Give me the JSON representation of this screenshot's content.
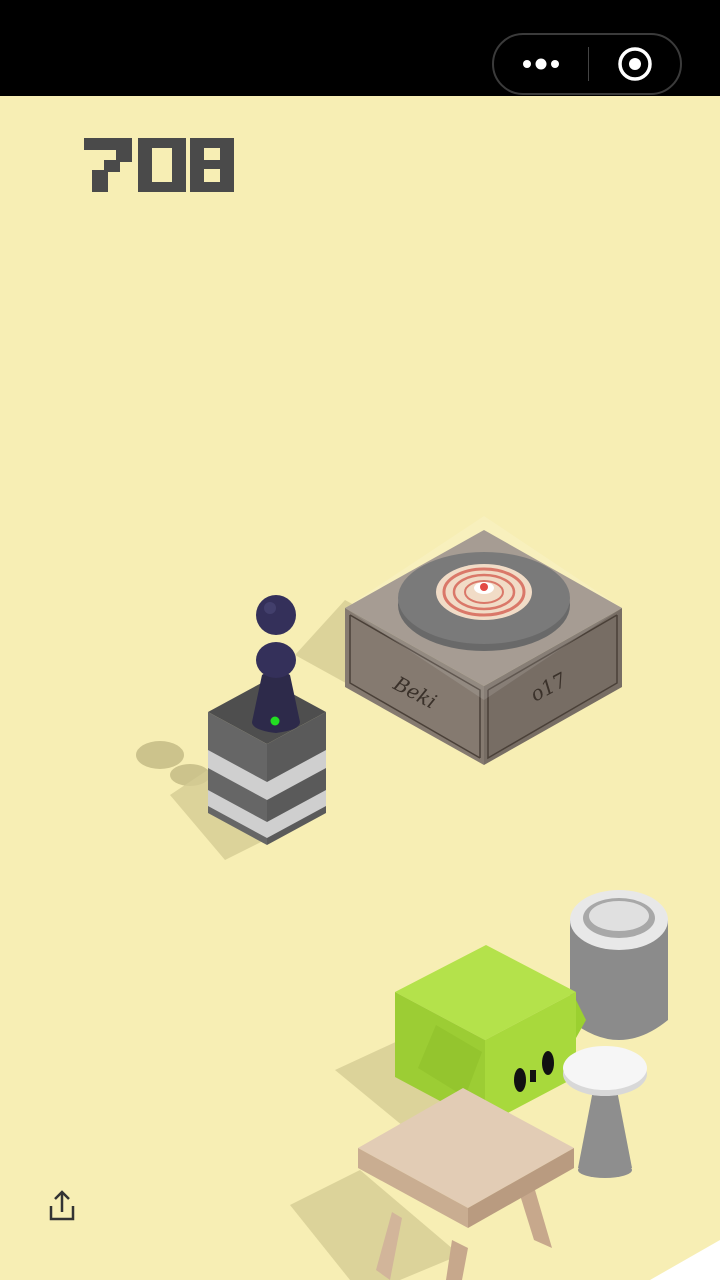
{
  "header": {
    "more_icon": "more-dots-icon",
    "close_icon": "target-circle-icon"
  },
  "game": {
    "score": "708",
    "crate_text_left": "Beki",
    "crate_text_right": "o17",
    "share_icon": "share-icon"
  },
  "colors": {
    "background": "#f7eeb4",
    "topbar": "#000000",
    "score": "#4a4a4a",
    "player": "#2d2a4a",
    "cube_green": "#9fd83a",
    "target_center": "#e0322c"
  }
}
